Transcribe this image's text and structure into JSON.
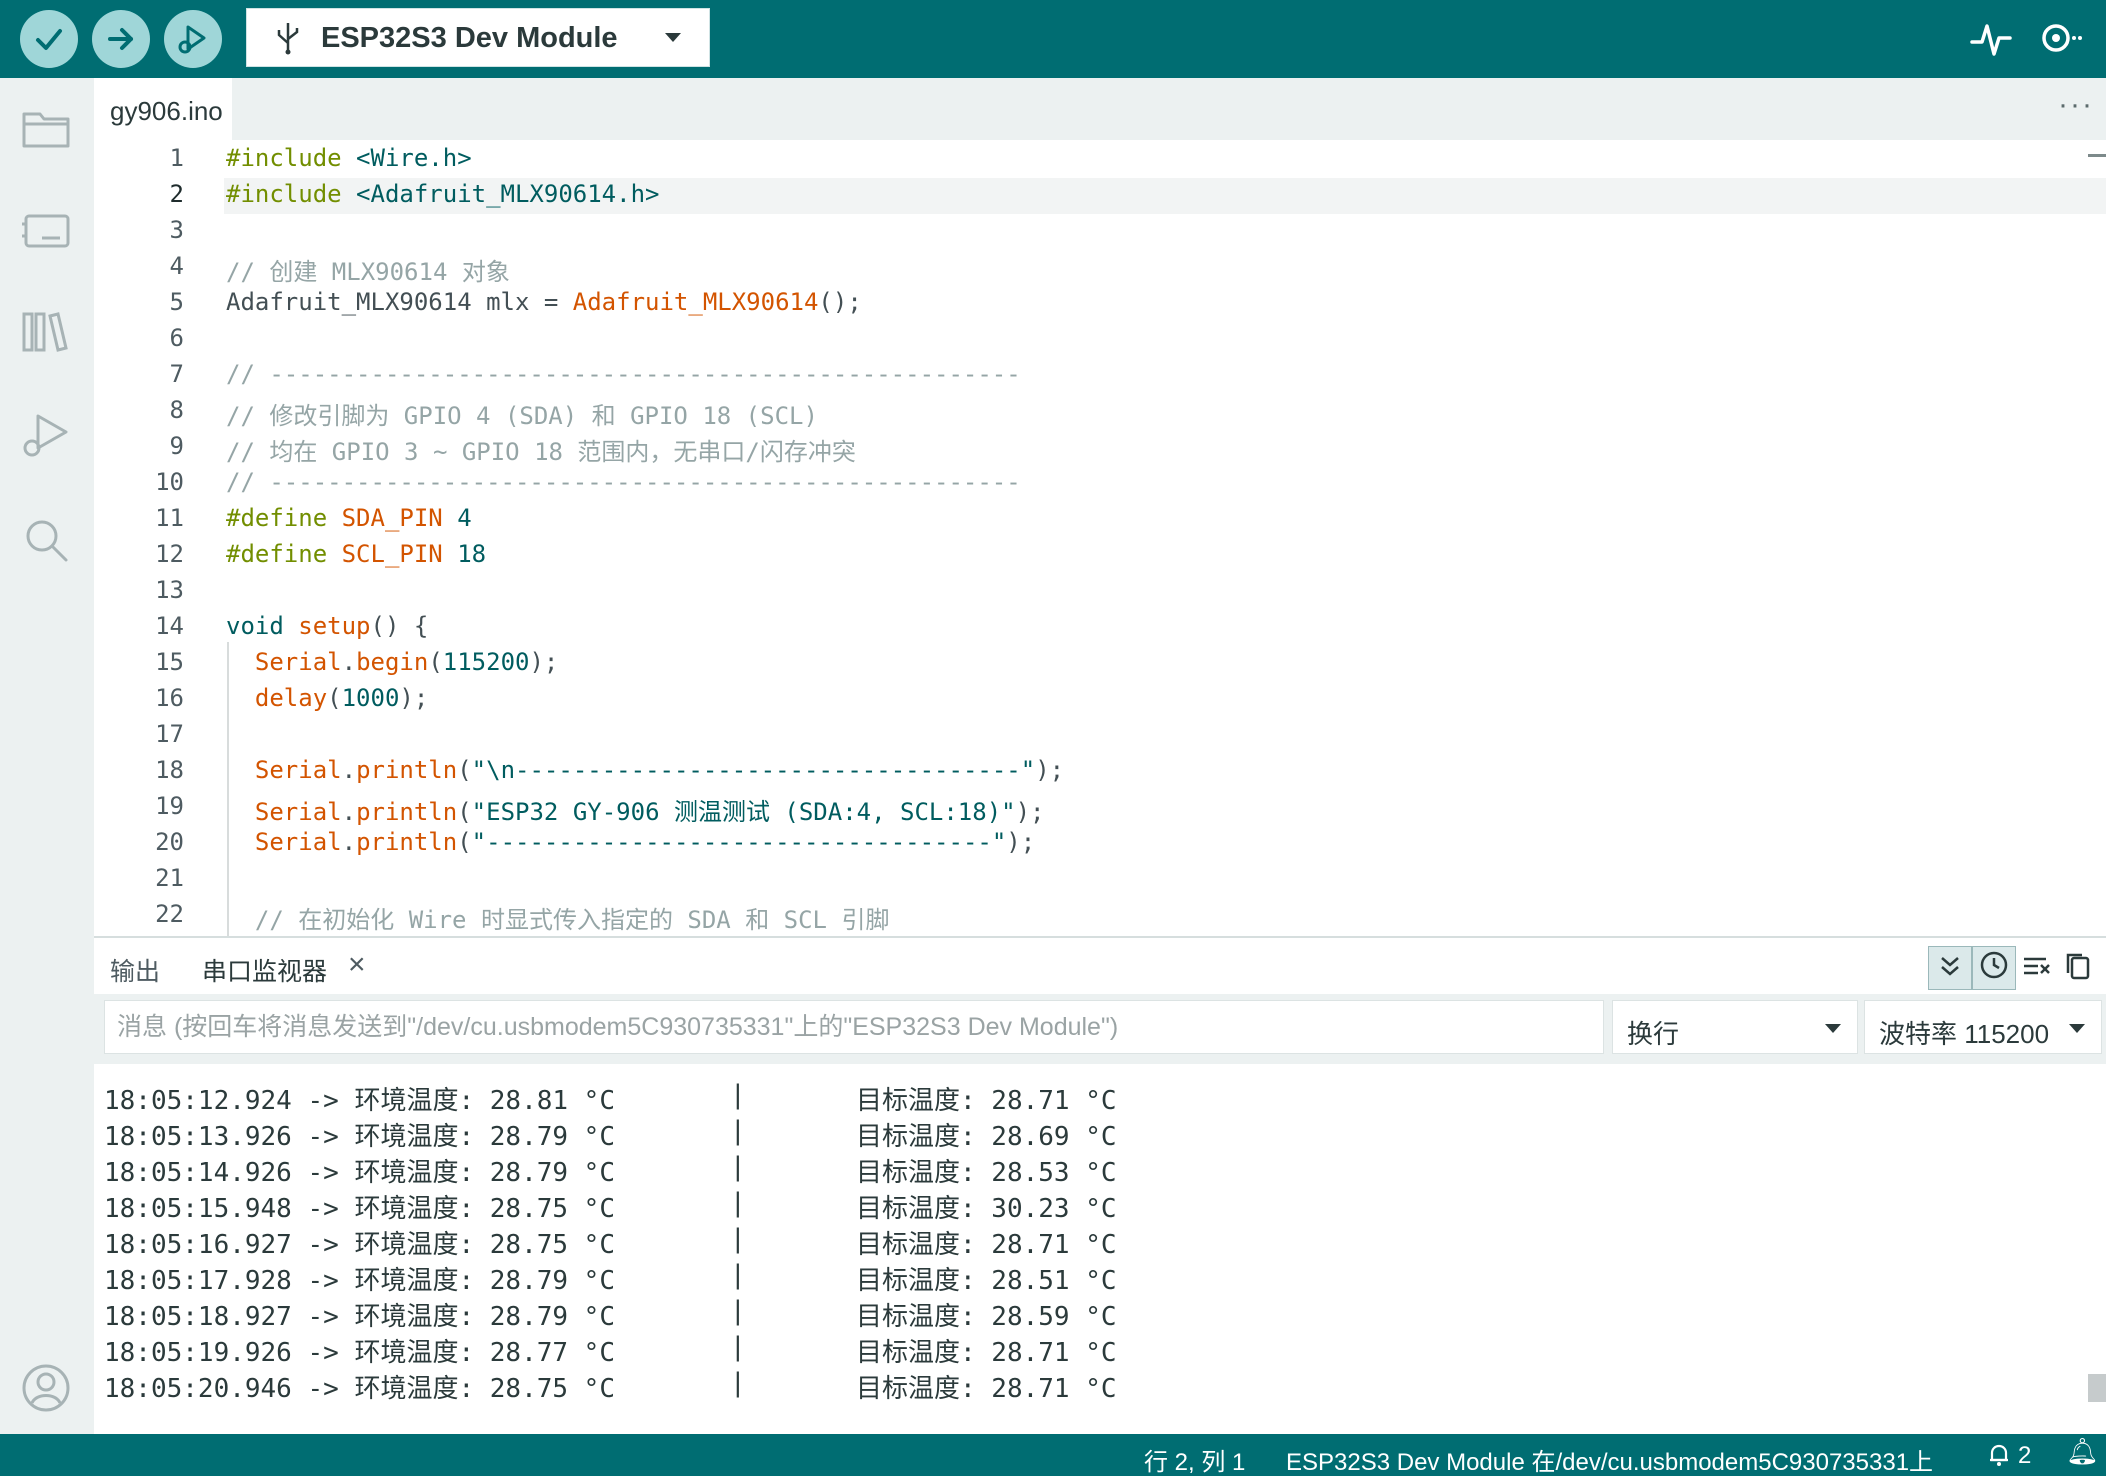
{
  "toolbar": {
    "board_name": "ESP32S3 Dev Module"
  },
  "editor": {
    "tab_name": "gy906.ino",
    "lines": [
      "1",
      "2",
      "3",
      "4",
      "5",
      "6",
      "7",
      "8",
      "9",
      "10",
      "11",
      "12",
      "13",
      "14",
      "15",
      "16",
      "17",
      "18",
      "19",
      "20",
      "21",
      "22"
    ],
    "code": {
      "l1_kw": "#include",
      "l1_rest": " <Wire.h>",
      "l2_kw": "#include",
      "l2_rest": " <Adafruit_MLX90614.h>",
      "l4": "// 创建 MLX90614 对象",
      "l5_a": "Adafruit_MLX90614 mlx = ",
      "l5_fn": "Adafruit_MLX90614",
      "l5_b": "();",
      "l7": "// ----------------------------------------------------",
      "l8": "// 修改引脚为 GPIO 4 (SDA) 和 GPIO 18 (SCL)",
      "l9": "// 均在 GPIO 3 ~ GPIO 18 范围内，无串口/闪存冲突",
      "l10": "// ----------------------------------------------------",
      "l11_kw": "#define",
      "l11_name": "SDA_PIN",
      "l11_val": "4",
      "l12_kw": "#define",
      "l12_name": "SCL_PIN",
      "l12_val": "18",
      "l14_kw": "void",
      "l14_fn": "setup",
      "l14_rest": "() {",
      "l15_obj": "Serial",
      "l15_fn": "begin",
      "l15_num": "115200",
      "l16_fn": "delay",
      "l16_num": "1000",
      "l18_obj": "Serial",
      "l18_fn": "println",
      "l18_str": "\"\\n-----------------------------------\"",
      "l19_obj": "Serial",
      "l19_fn": "println",
      "l19_str": "\"ESP32 GY-906 测温测试 (SDA:4, SCL:18)\"",
      "l20_obj": "Serial",
      "l20_fn": "println",
      "l20_str": "\"-----------------------------------\"",
      "l22": "// 在初始化 Wire 时显式传入指定的 SDA 和 SCL 引脚"
    }
  },
  "panel": {
    "tab_output": "输出",
    "tab_serial": "串口监视器",
    "message_placeholder": "消息 (按回车将消息发送到\"/dev/cu.usbmodem5C930735331\"上的\"ESP32S3 Dev Module\")",
    "line_ending": "换行",
    "baud_rate": "波特率 115200",
    "serial_lines": [
      {
        "time": "18:05:12.924",
        "ambient": "28.81",
        "object": "28.71"
      },
      {
        "time": "18:05:13.926",
        "ambient": "28.79",
        "object": "28.69"
      },
      {
        "time": "18:05:14.926",
        "ambient": "28.79",
        "object": "28.53"
      },
      {
        "time": "18:05:15.948",
        "ambient": "28.75",
        "object": "30.23"
      },
      {
        "time": "18:05:16.927",
        "ambient": "28.75",
        "object": "28.71"
      },
      {
        "time": "18:05:17.928",
        "ambient": "28.79",
        "object": "28.51"
      },
      {
        "time": "18:05:18.927",
        "ambient": "28.79",
        "object": "28.59"
      },
      {
        "time": "18:05:19.926",
        "ambient": "28.77",
        "object": "28.71"
      },
      {
        "time": "18:05:20.946",
        "ambient": "28.75",
        "object": "28.71"
      }
    ],
    "ambient_label": "环境温度:",
    "object_label": "目标温度:",
    "unit": "°C",
    "arrow": "->",
    "separator": "|"
  },
  "status": {
    "position": "行 2, 列 1",
    "board_port": "ESP32S3 Dev Module 在/dev/cu.usbmodem5C930735331上",
    "notifications": "2"
  },
  "colors": {
    "topbar": "#006d72",
    "button_bg": "#9fd6d8",
    "keyword": "#728e00",
    "function": "#d35400",
    "literal": "#005c5f",
    "comment": "#95a5a6"
  }
}
